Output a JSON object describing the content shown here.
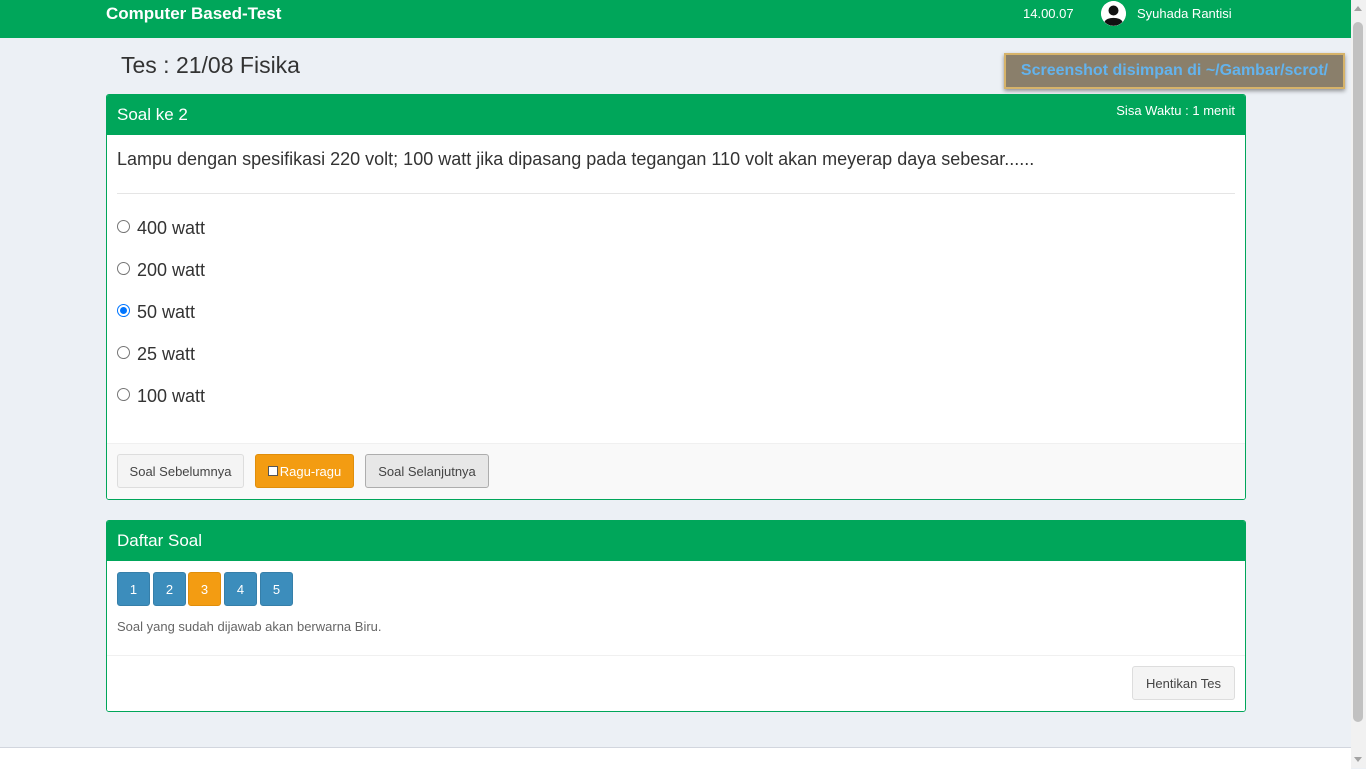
{
  "header": {
    "brand": "Computer Based-Test",
    "clock": "14.00.07",
    "username": "Syuhada Rantisi"
  },
  "page": {
    "title": "Tes : 21/08 Fisika"
  },
  "notification": {
    "text": "Screenshot disimpan di ~/Gambar/scrot/"
  },
  "question_panel": {
    "heading": "Soal ke 2",
    "time_left": "Sisa Waktu : 1 menit",
    "question": "Lampu dengan spesifikasi 220 volt; 100 watt jika dipasang pada tegangan 110 volt akan meyerap daya sebesar......",
    "options": [
      {
        "label": "400 watt",
        "checked": false
      },
      {
        "label": "200 watt",
        "checked": false
      },
      {
        "label": "50 watt",
        "checked": true
      },
      {
        "label": "25 watt",
        "checked": false
      },
      {
        "label": "100 watt",
        "checked": false
      }
    ],
    "buttons": {
      "previous": "Soal Sebelumnya",
      "doubt": "Ragu-ragu",
      "next": "Soal Selanjutnya"
    }
  },
  "list_panel": {
    "heading": "Daftar Soal",
    "numbers": [
      {
        "label": "1",
        "status": "answered"
      },
      {
        "label": "2",
        "status": "answered"
      },
      {
        "label": "3",
        "status": "doubt"
      },
      {
        "label": "4",
        "status": "answered"
      },
      {
        "label": "5",
        "status": "answered"
      }
    ],
    "hint": "Soal yang sudah dijawab akan berwarna Biru.",
    "stop_button": "Hentikan Tes"
  },
  "colors": {
    "primary_green": "#00a65a",
    "answered_blue": "#3c8dbc",
    "doubt_orange": "#f39c12",
    "radio_blue": "#0075ff"
  },
  "icons": {
    "user": "user-avatar-icon",
    "doubt_checkbox": "checkbox-icon"
  }
}
